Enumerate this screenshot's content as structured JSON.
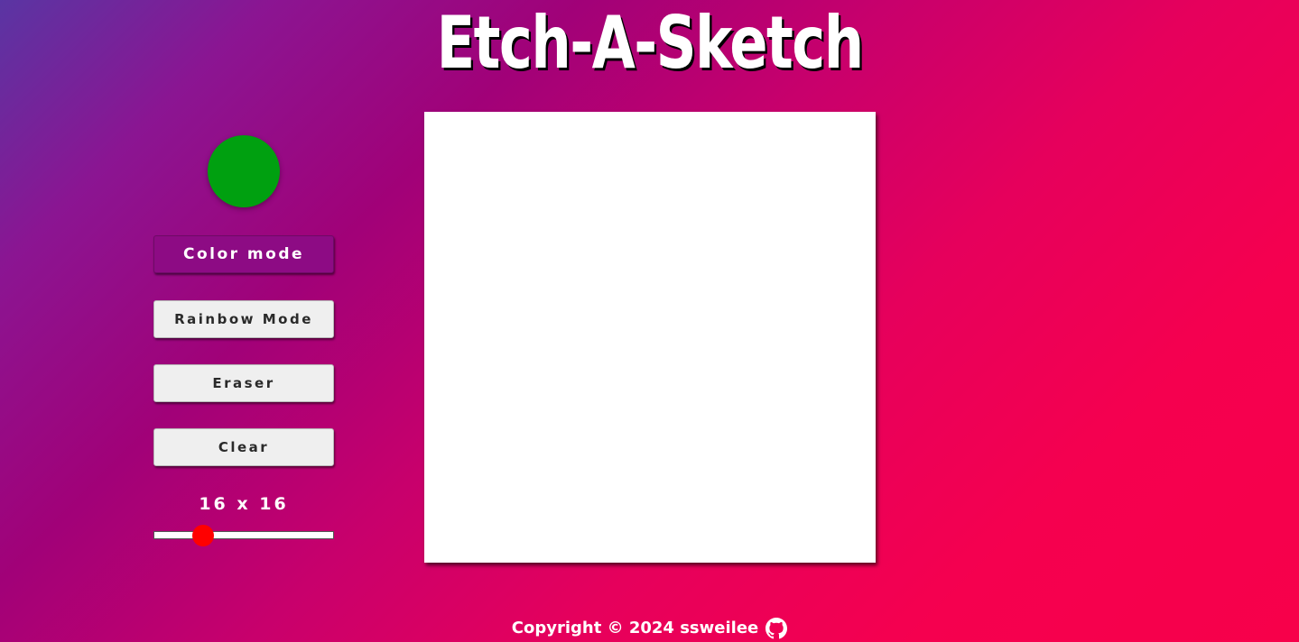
{
  "app": {
    "title": "Etch-A-Sketch"
  },
  "controls": {
    "current_color": "#00a010",
    "buttons": {
      "color_mode": "Color mode",
      "rainbow_mode": "Rainbow Mode",
      "eraser": "Eraser",
      "clear": "Clear"
    },
    "active_mode": "color_mode",
    "grid_size_label": "16 x 16",
    "grid_size": {
      "value": 16,
      "min": 1,
      "max": 100
    },
    "slider_thumb_color": "#ff0000"
  },
  "footer": {
    "copyright": "Copyright © 2024 ssweilee",
    "icon": "github-icon"
  }
}
